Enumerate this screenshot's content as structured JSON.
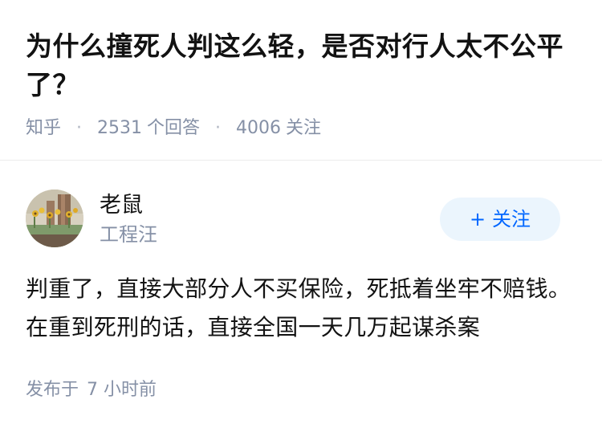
{
  "question": {
    "title": "为什么撞死人判这么轻，是否对行人太不公平了？",
    "meta": {
      "source": "知乎",
      "separator": "·",
      "answer_count": "2531",
      "answer_label": "个回答",
      "follower_count": "4006",
      "follower_label": "关注"
    }
  },
  "answer": {
    "author": {
      "name": "老鼠",
      "headline": "工程汪",
      "avatar_icon": "avatar-photo-sunflowers"
    },
    "follow_button": {
      "icon": "plus-icon",
      "icon_glyph": "+",
      "label": "关注"
    },
    "content": "判重了，直接大部分人不买保险，死抵着坐牢不赔钱。在重到死刑的话，直接全国一天几万起谋杀案",
    "published_label": "发布于",
    "published_time": "7 小时前"
  },
  "colors": {
    "text_primary": "#121212",
    "text_secondary": "#8590a6",
    "accent": "#0066ff",
    "follow_bg": "#ebf5fd",
    "divider": "#ececec"
  }
}
